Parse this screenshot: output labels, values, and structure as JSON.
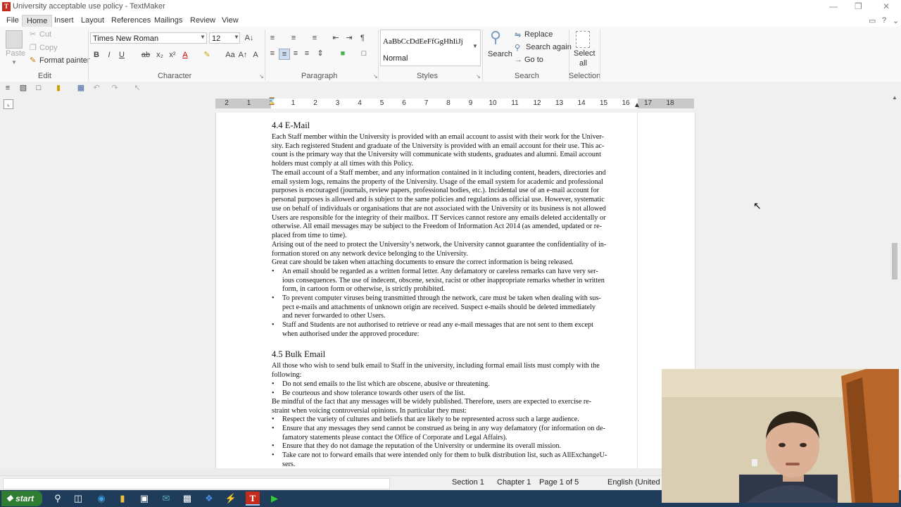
{
  "window": {
    "title": "University acceptable use policy - TextMaker",
    "app_icon_letter": "T"
  },
  "menu": [
    "File",
    "Home",
    "Insert",
    "Layout",
    "References",
    "Mailings",
    "Review",
    "View"
  ],
  "ribbon": {
    "edit": {
      "paste": "Paste",
      "cut": "Cut",
      "copy": "Copy",
      "format_painter": "Format painter",
      "label": "Edit"
    },
    "character": {
      "font": "Times New Roman",
      "size": "12",
      "label": "Character"
    },
    "paragraph": {
      "label": "Paragraph"
    },
    "styles": {
      "sample": "AaBbCcDdEeFfGgHhIiJj",
      "current": "Normal",
      "label": "Styles"
    },
    "search": {
      "search": "Search",
      "replace": "Replace",
      "search_again": "Search again",
      "goto": "Go to",
      "label": "Search"
    },
    "selection": {
      "select_all_1": "Select",
      "select_all_2": "all",
      "label": "Selection"
    }
  },
  "ruler": [
    "2",
    "1",
    "1",
    "1",
    "2",
    "3",
    "4",
    "5",
    "6",
    "7",
    "8",
    "9",
    "10",
    "11",
    "12",
    "13",
    "14",
    "15",
    "16",
    "17",
    "18"
  ],
  "document": {
    "h44": "4.4 E-Mail",
    "p1": [
      "Each Staff member within the University is provided with an email account to assist with their work for the Univer-",
      "sity. Each registered Student and graduate of the University is provided with an email account for their use. This ac-",
      "count is the primary way that the University will communicate with students, graduates and alumni. Email account",
      "holders must comply at all times with this Policy."
    ],
    "p2": [
      "The email account of a Staff member, and any information contained in it including content, headers, directories and",
      "email system logs, remains the property of the University. Usage of the email system for academic and professional",
      "purposes is encouraged (journals, review papers, professional bodies, etc.). Incidental use of an e-mail account for",
      "personal purposes is allowed and is subject to the same policies and regulations as official use. However, systematic",
      "use on behalf of individuals or organisations that are not associated with the University or its business is not allowed",
      "Users are responsible for the integrity of their mailbox. IT Services cannot restore any emails deleted accidentally or",
      "otherwise. All email messages may be subject to the Freedom of Information Act 2014 (as amended, updated or re-",
      "placed from time to time)."
    ],
    "p3": [
      "Arising out of the need to protect the University’s network, the University cannot guarantee the confidentiality of in-",
      "formation stored on any network device belonging to the University."
    ],
    "p4": "Great care should be taken when attaching documents to ensure the correct information is being released.",
    "b1": [
      "An email should be regarded as a written formal letter. Any defamatory or careless remarks can have very ser-",
      "ious consequences. The use of indecent, obscene, sexist, racist or other inappropriate remarks whether in written",
      "form, in cartoon form or otherwise, is strictly prohibited."
    ],
    "b2": [
      "To prevent computer viruses being transmitted through the network, care must be taken when dealing with sus-",
      "pect e-mails and attachments of unknown origin are received. Suspect e-mails should be deleted immediately",
      "and never forwarded to other Users."
    ],
    "b3": [
      "Staff and Students are not authorised to retrieve or read any e-mail messages that are not sent to them except",
      "when authorised under the approved procedure:"
    ],
    "h45": "4.5 Bulk Email",
    "p5": [
      "All those who wish to send bulk email to Staff in the university, including formal email lists must comply with the",
      "following:"
    ],
    "b4": "Do not send emails to the list which are obscene, abusive or threatening.",
    "b5": "Be courteous and show tolerance towards other users of the list.",
    "p6": [
      "Be mindful of the fact that any messages will be widely published. Therefore, users are expected to exercise re-",
      "straint when voicing controversial opinions. In particular they must:"
    ],
    "b6": "Respect the variety of cultures and beliefs that are likely to be represented across such a large audience.",
    "b7": [
      "Ensure that any messages they send cannot be construed as being in any way defamatory (for information on de-",
      "famatory statements please contact the Office of Corporate and Legal Affairs)."
    ],
    "b8": "Ensure that they do not damage the reputation of the University or undermine its overall mission.",
    "b9": [
      "Take care not to forward emails that were intended only for them to bulk distribution list, such as AllExchangeU-",
      "sers."
    ]
  },
  "status": {
    "section": "Section 1",
    "chapter": "Chapter 1",
    "page": "Page 1 of 5",
    "language": "English (United Ki"
  },
  "taskbar": {
    "start": "start"
  }
}
